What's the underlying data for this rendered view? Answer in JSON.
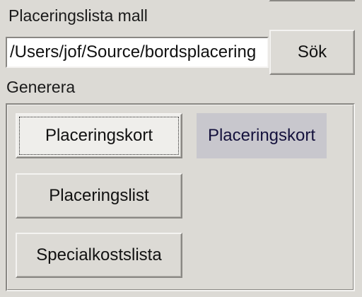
{
  "template": {
    "label": "Placeringslista mall",
    "path_value": "/Users/jof/Source/bordsplacering",
    "search_label": "Sök"
  },
  "generate": {
    "label": "Generera",
    "cards_button": "Placeringskort",
    "cards_status": "Placeringskort",
    "list_button": "Placeringslist",
    "special_button": "Specialkostslista"
  },
  "colors": {
    "background": "#dcdad5",
    "status_background": "#c8c7cd",
    "status_text": "#15123d",
    "input_background": "#ffffff"
  }
}
